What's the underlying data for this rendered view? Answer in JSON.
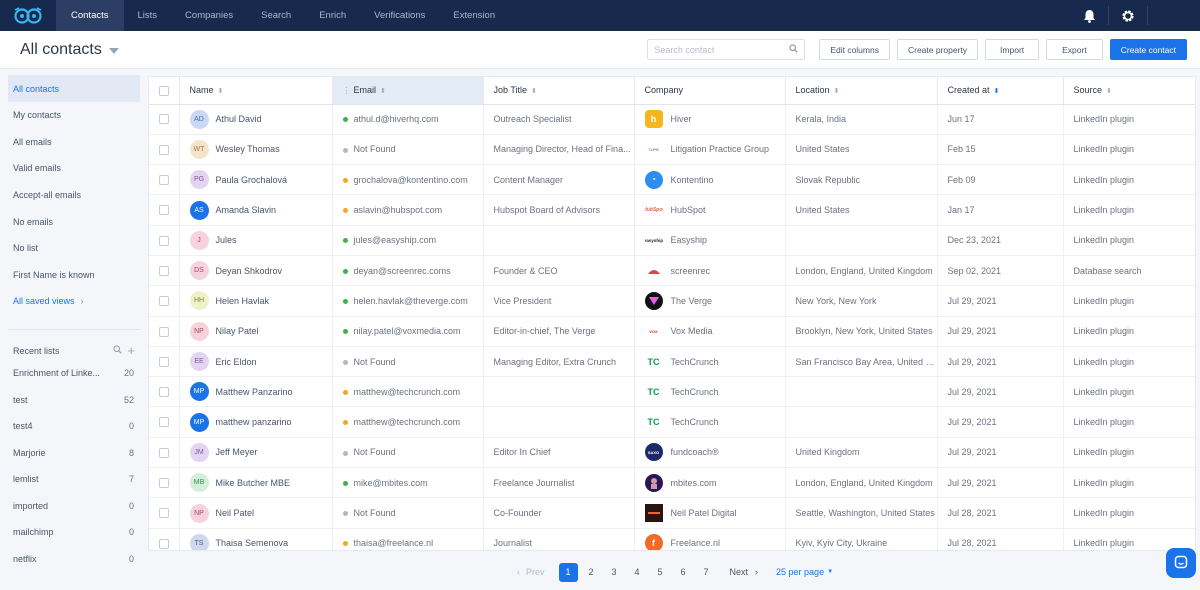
{
  "nav": {
    "tabs": [
      "Contacts",
      "Lists",
      "Companies",
      "Search",
      "Enrich",
      "Verifications",
      "Extension"
    ],
    "active_tab": "Contacts",
    "brand_color": "#172a4e",
    "icons": [
      "logo-icon",
      "bell-icon",
      "gear-icon"
    ]
  },
  "header": {
    "title": "All contacts",
    "search_placeholder": "Search contact",
    "buttons": {
      "edit_columns": "Edit columns",
      "create_property": "Create property",
      "import": "Import",
      "export": "Export",
      "create_contact": "Create contact"
    },
    "accent_color": "#1a73e8"
  },
  "sidebar": {
    "views": [
      "All contacts",
      "My contacts",
      "All emails",
      "Valid emails",
      "Accept-all emails",
      "No emails",
      "No list",
      "First Name is known"
    ],
    "saved_views_link": "All saved views",
    "recent_lists_title": "Recent lists",
    "recent_lists": [
      {
        "name": "Enrichment of Linke...",
        "count": "20"
      },
      {
        "name": "test",
        "count": "52"
      },
      {
        "name": "test4",
        "count": "0"
      },
      {
        "name": "Marjorie",
        "count": "8"
      },
      {
        "name": "lemlist",
        "count": "7"
      },
      {
        "name": "imported",
        "count": "0"
      },
      {
        "name": "mailchimp",
        "count": "0"
      },
      {
        "name": "netflix",
        "count": "0"
      }
    ]
  },
  "table": {
    "columns": [
      "Name",
      "Email",
      "Job Title",
      "Company",
      "Location",
      "Created at",
      "Source"
    ],
    "rows": [
      {
        "initials": "AD",
        "name": "Athul David",
        "email": "athul.d@hiverhq.com",
        "email_status": "valid",
        "job": "Outreach Specialist",
        "company": "Hiver",
        "location": "Kerala, India",
        "created": "Jun 17",
        "source": "LinkedIn plugin"
      },
      {
        "initials": "WT",
        "name": "Wesley Thomas",
        "email": "Not Found",
        "email_status": "none",
        "job": "Managing Director, Head of Fina...",
        "company": "Litigation Practice Group",
        "location": "United States",
        "created": "Feb 15",
        "source": "LinkedIn plugin"
      },
      {
        "initials": "PG",
        "name": "Paula Grochalová",
        "email": "grochalova@kontentino.com",
        "email_status": "accept",
        "job": "Content Manager",
        "company": "Kontentino",
        "location": "Slovak Republic",
        "created": "Feb 09",
        "source": "LinkedIn plugin"
      },
      {
        "initials": "AS",
        "name": "Amanda Slavin",
        "email": "aslavin@hubspot.com",
        "email_status": "accept",
        "job": "Hubspot Board of Advisors",
        "company": "HubSpot",
        "location": "United States",
        "created": "Jan 17",
        "source": "LinkedIn plugin"
      },
      {
        "initials": "J",
        "name": "Jules",
        "email": "jules@easyship.com",
        "email_status": "valid",
        "job": "",
        "company": "Easyship",
        "location": "",
        "created": "Dec 23, 2021",
        "source": "LinkedIn plugin"
      },
      {
        "initials": "DS",
        "name": "Deyan Shkodrov",
        "email": "deyan@screenrec.coms",
        "email_status": "valid",
        "job": "Founder & CEO",
        "company": "screenrec",
        "location": "London, England, United Kingdom",
        "created": "Sep 02, 2021",
        "source": "Database search"
      },
      {
        "initials": "HH",
        "name": "Helen Havlak",
        "email": "helen.havlak@theverge.com",
        "email_status": "valid",
        "job": "Vice President",
        "company": "The Verge",
        "location": "New York, New York",
        "created": "Jul 29, 2021",
        "source": "LinkedIn plugin"
      },
      {
        "initials": "NP",
        "name": "Nilay Patel",
        "email": "nilay.patel@voxmedia.com",
        "email_status": "valid",
        "job": "Editor-in-chief, The Verge",
        "company": "Vox Media",
        "location": "Brooklyn, New York, United States",
        "created": "Jul 29, 2021",
        "source": "LinkedIn plugin"
      },
      {
        "initials": "EE",
        "name": "Eric Eldon",
        "email": "Not Found",
        "email_status": "none",
        "job": "Managing Editor, Extra Crunch",
        "company": "TechCrunch",
        "location": "San Francisco Bay Area, United S...",
        "created": "Jul 29, 2021",
        "source": "LinkedIn plugin"
      },
      {
        "initials": "MP",
        "name": "Matthew Panzarino",
        "email": "matthew@techcrunch.com",
        "email_status": "accept",
        "job": "",
        "company": "TechCrunch",
        "location": "",
        "created": "Jul 29, 2021",
        "source": "LinkedIn plugin"
      },
      {
        "initials": "MP",
        "name": "matthew panzarino",
        "email": "matthew@techcrunch.com",
        "email_status": "accept",
        "job": "",
        "company": "TechCrunch",
        "location": "",
        "created": "Jul 29, 2021",
        "source": "LinkedIn plugin"
      },
      {
        "initials": "JM",
        "name": "Jeff Meyer",
        "email": "Not Found",
        "email_status": "none",
        "job": "Editor In Chief",
        "company": "fundcoach®",
        "location": "United Kingdom",
        "created": "Jul 29, 2021",
        "source": "LinkedIn plugin"
      },
      {
        "initials": "MB",
        "name": "Mike Butcher MBE",
        "email": "mike@mbites.com",
        "email_status": "valid",
        "job": "Freelance Journalist",
        "company": "mbites.com",
        "location": "London, England, United Kingdom",
        "created": "Jul 29, 2021",
        "source": "LinkedIn plugin"
      },
      {
        "initials": "NP",
        "name": "Neil Patel",
        "email": "Not Found",
        "email_status": "none",
        "job": "Co-Founder",
        "company": "Neil Patel Digital",
        "location": "Seattle, Washington, United States",
        "created": "Jul 28, 2021",
        "source": "LinkedIn plugin"
      },
      {
        "initials": "TS",
        "name": "Thaisa Semenova",
        "email": "thaisa@freelance.nl",
        "email_status": "accept",
        "job": "Journalist",
        "company": "Freelance.nl",
        "location": "Kyiv, Kyiv City, Ukraine",
        "created": "Jul 28, 2021",
        "source": "LinkedIn plugin"
      }
    ],
    "status_colors": {
      "valid": "#3bb54a",
      "accept": "#f5a623",
      "none": "#b0b7c3"
    }
  },
  "pagination": {
    "prev": "Prev",
    "pages": [
      "1",
      "2",
      "3",
      "4",
      "5",
      "6",
      "7"
    ],
    "current": "1",
    "next": "Next",
    "per_page": "25 per page"
  }
}
